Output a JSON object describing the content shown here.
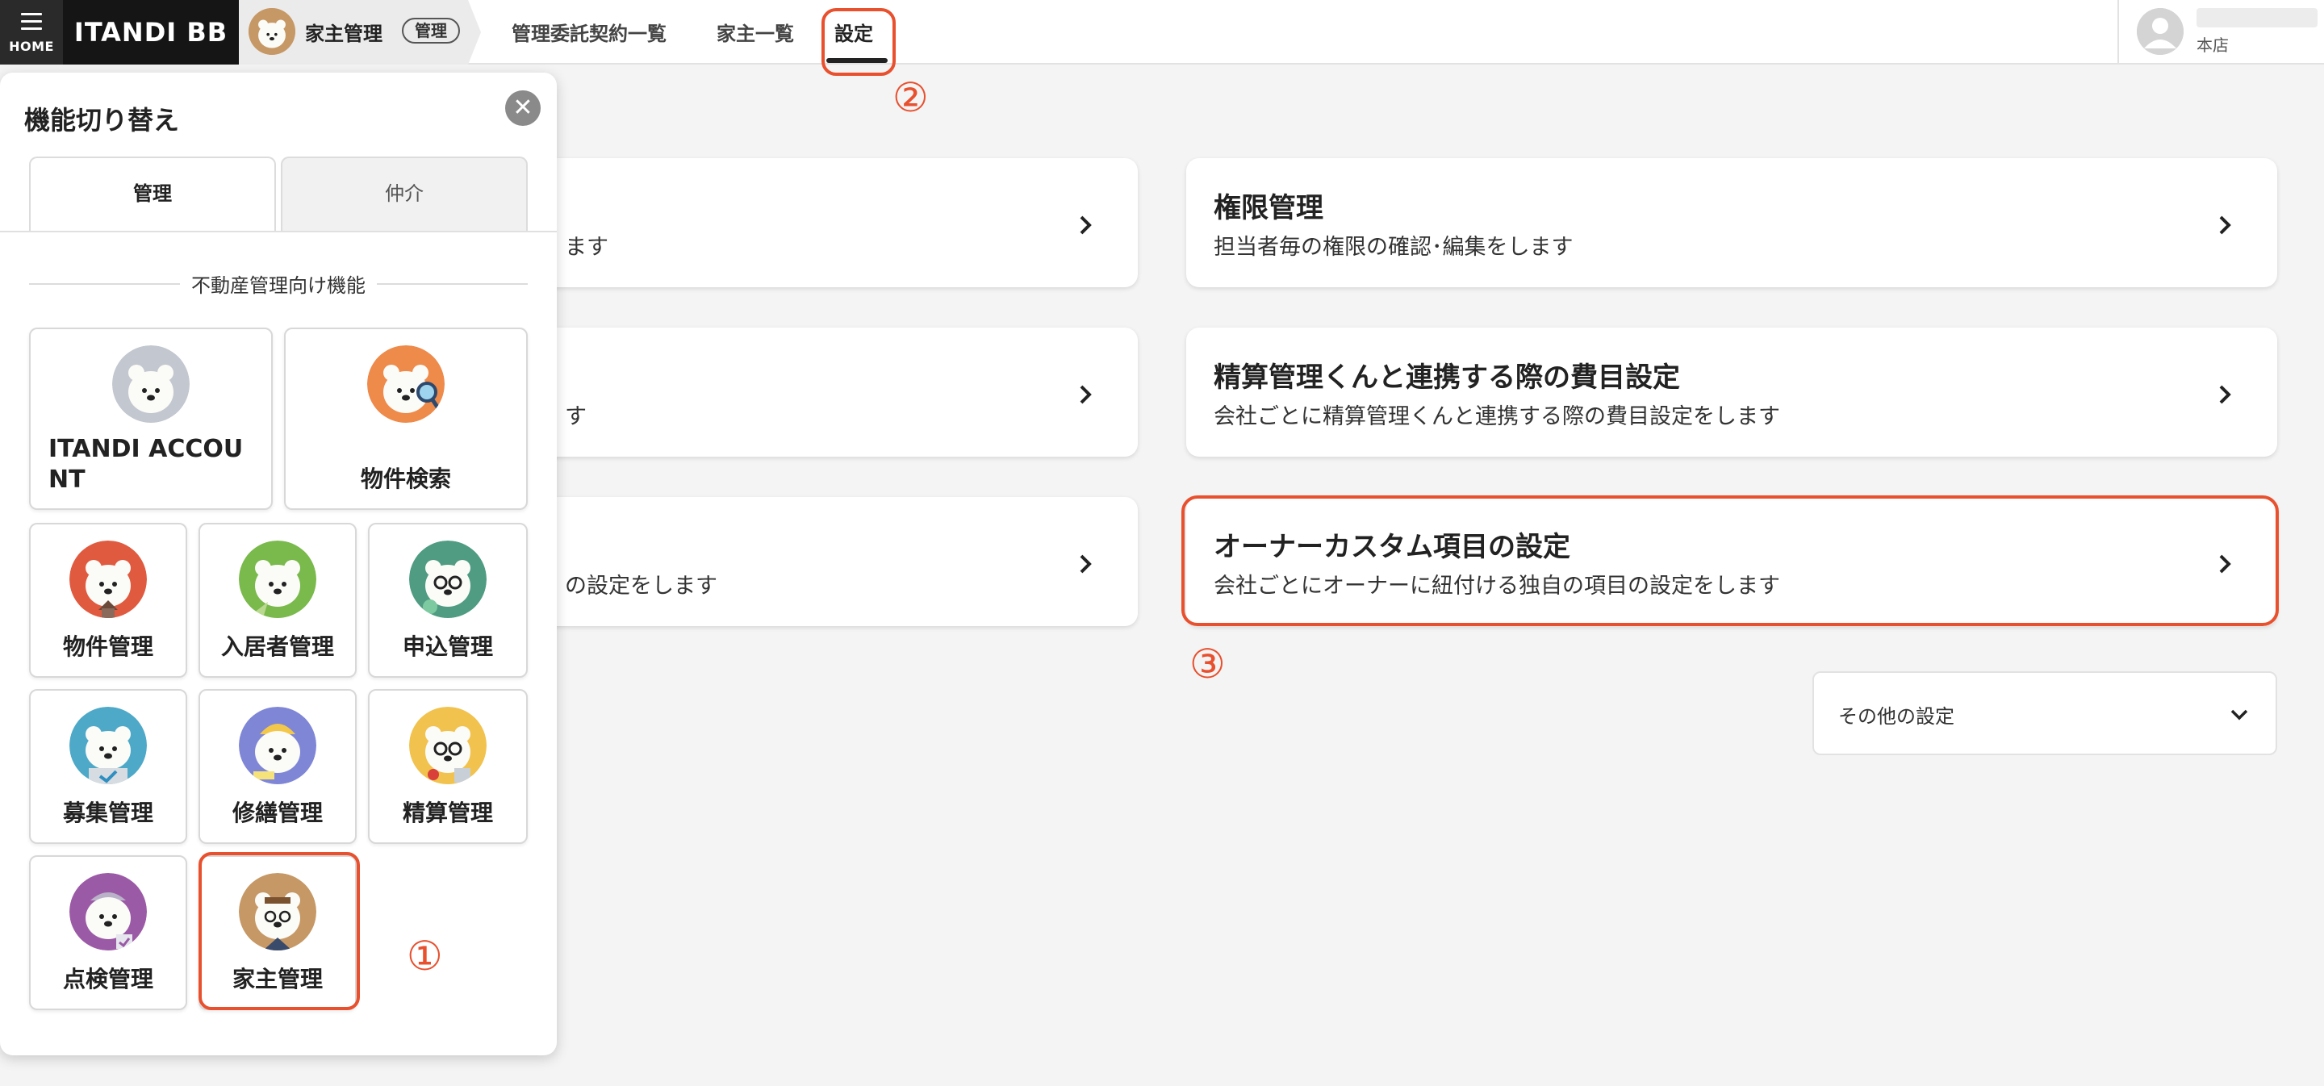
{
  "header": {
    "menu_label": "HOME",
    "brand": "ITANDI BB",
    "breadcrumb_title": "家主管理",
    "breadcrumb_badge": "管理",
    "nav": [
      "管理委託契約一覧",
      "家主一覧",
      "設定"
    ],
    "user_branch": "本店"
  },
  "annotations": {
    "one": "①",
    "two": "②",
    "three": "③"
  },
  "cards": {
    "left_1_desc": "ます",
    "left_2_desc": "す",
    "left_3_desc": "の設定をします",
    "right_1_title": "権限管理",
    "right_1_desc": "担当者毎の権限の確認･編集をします",
    "right_2_title": "精算管理くんと連携する際の費目設定",
    "right_2_desc": "会社ごとに精算管理くんと連携する際の費目設定をします",
    "right_3_title": "オーナーカスタム項目の設定",
    "right_3_desc": "会社ごとにオーナーに紐付ける独自の項目の設定をします",
    "other_settings": "その他の設定"
  },
  "panel": {
    "title": "機能切り替え",
    "tabs": [
      "管理",
      "仲介"
    ],
    "section": "不動産管理向け機能",
    "tiles": {
      "account": "ITANDI ACCOUNT",
      "search": "物件検索",
      "property": "物件管理",
      "resident": "入居者管理",
      "application": "申込管理",
      "recruit": "募集管理",
      "repair": "修繕管理",
      "settlement": "精算管理",
      "inspection": "点検管理",
      "owner": "家主管理"
    }
  },
  "colors": {
    "highlight": "#e8502e",
    "account": "#c3c7cf",
    "search": "#ee8a4a",
    "property": "#e05a3f",
    "resident": "#7ab94b",
    "application": "#4f9c82",
    "recruit": "#4ea9c8",
    "repair": "#7f86d6",
    "settlement": "#f1c24d",
    "inspection": "#9b5aa6",
    "owner": "#c69866"
  }
}
